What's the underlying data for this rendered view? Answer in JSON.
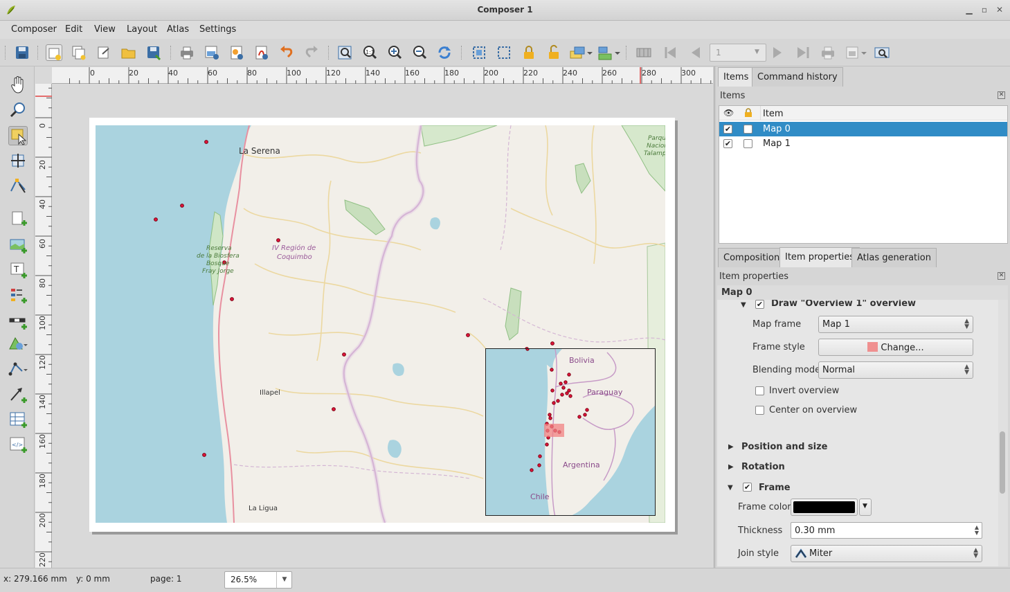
{
  "window": {
    "title": "Composer 1"
  },
  "menu": [
    "Composer",
    "Edit",
    "View",
    "Layout",
    "Atlas",
    "Settings"
  ],
  "toolbar": {
    "page_field": "1"
  },
  "rulers": {
    "h_ticks": [
      "0",
      "20",
      "40",
      "60",
      "80",
      "100",
      "120",
      "140",
      "160",
      "180",
      "200",
      "220",
      "240",
      "260",
      "280",
      "300"
    ],
    "v_ticks": [
      "0",
      "20",
      "40",
      "60",
      "80",
      "100",
      "120",
      "140",
      "160",
      "180",
      "200",
      "220"
    ]
  },
  "map": {
    "labels": {
      "la_serena": "La Serena",
      "illapel": "Illapel",
      "la_ligua": "La Ligua",
      "region": "IV Región de Coquimbo",
      "reserva": "Reserva de la Biosfera Bosque Fray Jorge",
      "parque": "Parque Nacional Talampaya"
    },
    "overview_labels": {
      "bolivia": "Bolivia",
      "paraguay": "Paraguay",
      "argentina": "Argentina",
      "chile": "Chile"
    }
  },
  "panel_tabs_top": [
    "Items",
    "Command history"
  ],
  "items_panel": {
    "title": "Items",
    "column_header": "Item",
    "rows": [
      {
        "name": "Map 0",
        "visible": true,
        "locked": false,
        "selected": true
      },
      {
        "name": "Map 1",
        "visible": true,
        "locked": false,
        "selected": false
      }
    ]
  },
  "panel_tabs_bottom": [
    "Composition",
    "Item properties",
    "Atlas generation"
  ],
  "item_properties": {
    "title": "Item properties",
    "item_name": "Map 0",
    "overview_group": "Draw \"Overview 1\" overview",
    "map_frame_label": "Map frame",
    "map_frame_value": "Map 1",
    "frame_style_label": "Frame style",
    "frame_style_button": "Change...",
    "blending_label": "Blending mode",
    "blending_value": "Normal",
    "invert_label": "Invert overview",
    "center_label": "Center on overview",
    "position_group": "Position and size",
    "rotation_group": "Rotation",
    "frame_group": "Frame",
    "frame_color_label": "Frame color",
    "thickness_label": "Thickness",
    "thickness_value": "0.30 mm",
    "join_label": "Join style",
    "join_value": "Miter"
  },
  "status": {
    "x": "x: 279.166 mm",
    "y": "y: 0 mm",
    "page": "page: 1",
    "zoom": "26.5%"
  },
  "colors": {
    "selection": "#308cc6",
    "water": "#aad3df",
    "land": "#f2efe9",
    "border": "#c79bc7",
    "point": "#e0143c"
  }
}
